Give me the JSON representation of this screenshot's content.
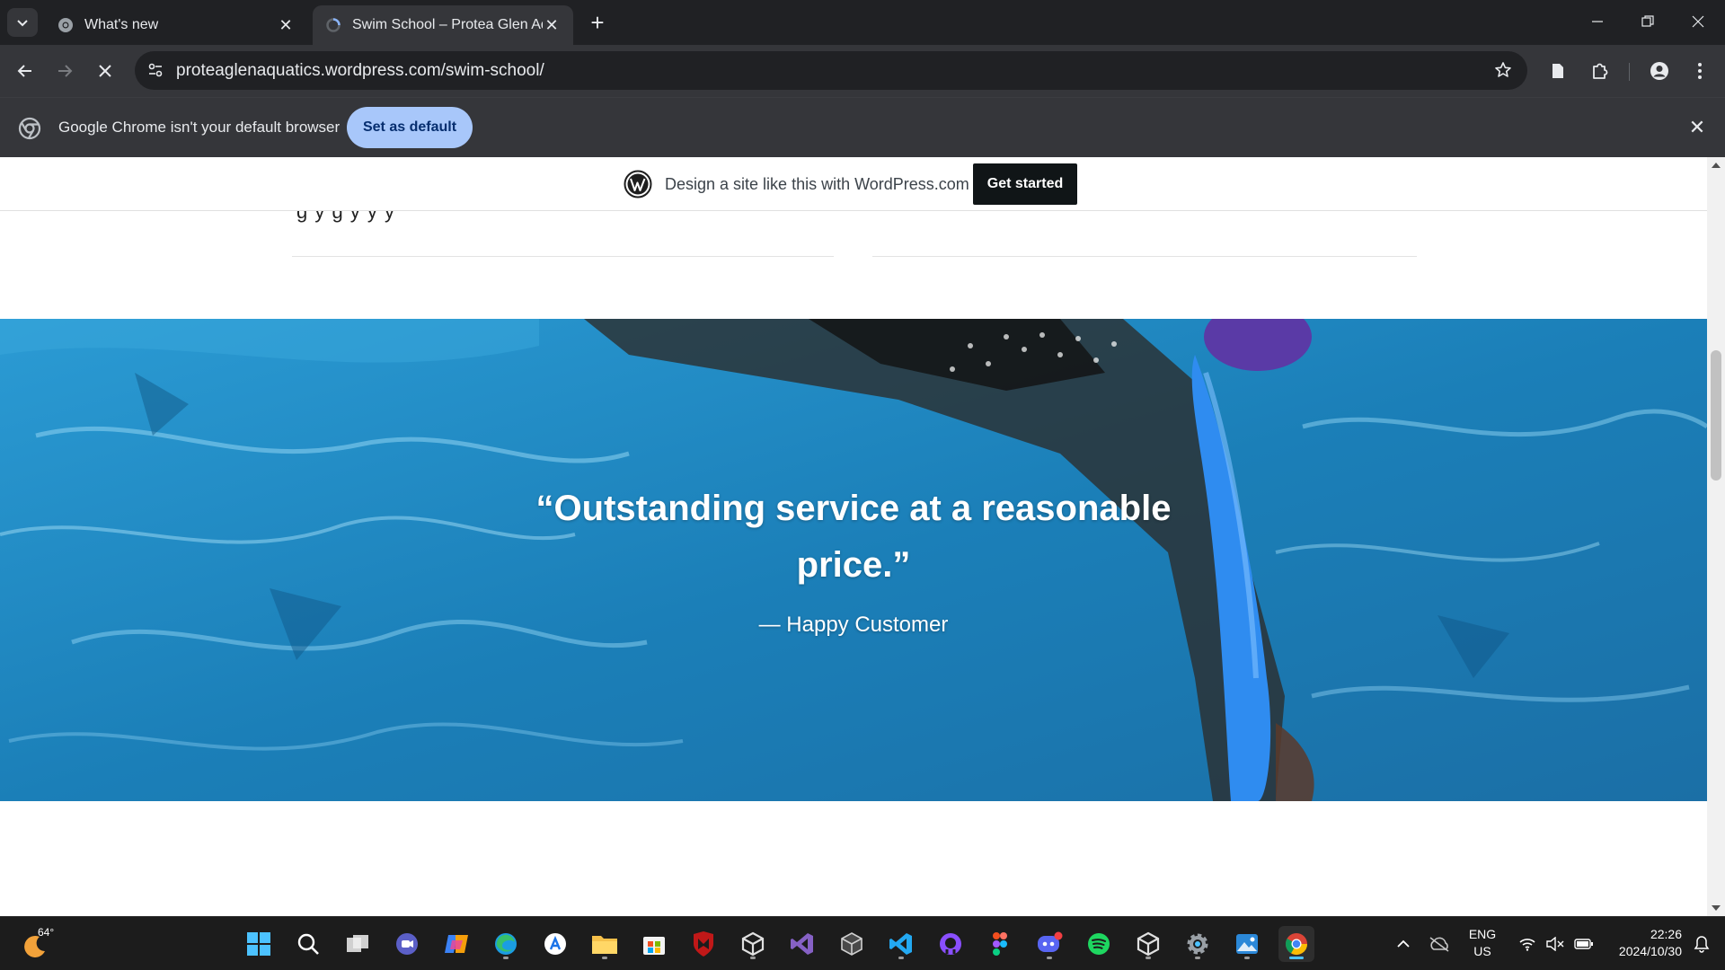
{
  "browser": {
    "tabs": [
      {
        "title": "What's new",
        "active": false
      },
      {
        "title": "Swim School – Protea Glen Aqu",
        "active": true
      }
    ],
    "url": "proteaglenaquatics.wordpress.com/swim-school/"
  },
  "infobar": {
    "message": "Google Chrome isn't your default browser",
    "button": "Set as default"
  },
  "wp_banner": {
    "text": "Design a site like this with WordPress.com",
    "button": "Get started"
  },
  "page": {
    "partial_text": "g   y         g  y  y    y",
    "testimonial": {
      "quote": "“Outstanding service at a reasonable price.”",
      "cite": "— Happy Customer"
    }
  },
  "taskbar": {
    "weather_temp": "64°",
    "language": "ENG",
    "region": "US",
    "time": "22:26",
    "date": "2024/10/30",
    "apps": [
      "start",
      "search",
      "task-view",
      "teams",
      "copilot",
      "edge",
      "app-store",
      "file-explorer",
      "microsoft-store",
      "mcafee",
      "unity",
      "visual-studio",
      "unity-hub",
      "vscode",
      "github-desktop",
      "figma",
      "discord",
      "spotify",
      "unity-2",
      "settings",
      "photos",
      "chrome"
    ]
  },
  "colors": {
    "hero_water": "#1e7eb5",
    "accent": "#a8c7fa",
    "wp_button": "#101517"
  }
}
